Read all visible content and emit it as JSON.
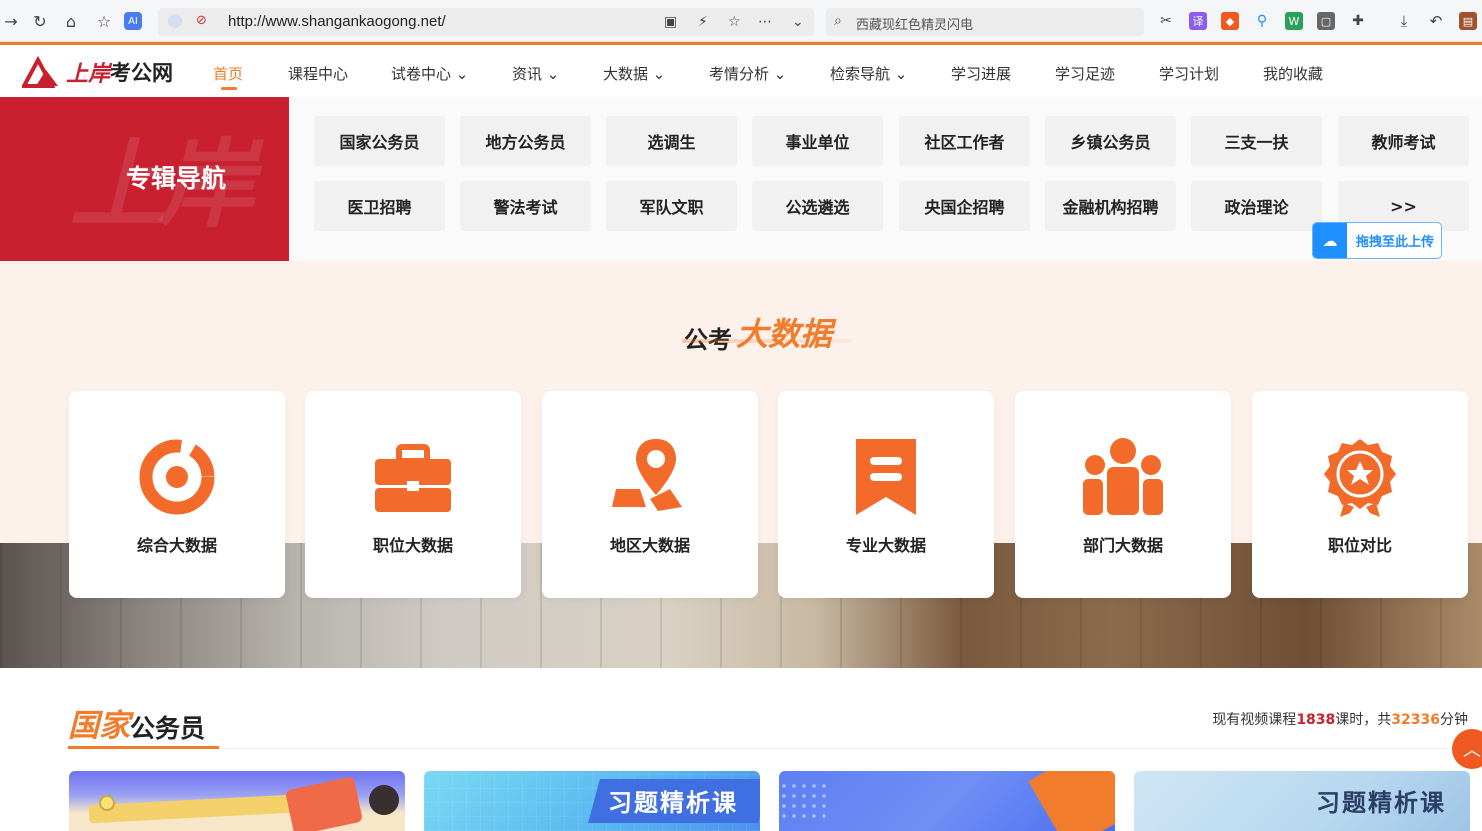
{
  "browser": {
    "url": "http://www.shangankaogong.net/",
    "search_placeholder": "西藏现红色精灵闪电"
  },
  "site": {
    "logo_brand": "上岸",
    "logo_suffix": "考公网",
    "nav": [
      {
        "label": "首页",
        "active": true
      },
      {
        "label": "课程中心"
      },
      {
        "label": "试卷中心"
      },
      {
        "label": "资讯"
      },
      {
        "label": "大数据"
      },
      {
        "label": "考情分析"
      },
      {
        "label": "检索导航"
      },
      {
        "label": "学习进展"
      },
      {
        "label": "学习足迹"
      },
      {
        "label": "学习计划"
      },
      {
        "label": "我的收藏"
      }
    ]
  },
  "special_nav": {
    "title": "专辑导航",
    "bg_text": "上岸",
    "tags": [
      "国家公务员",
      "地方公务员",
      "选调生",
      "事业单位",
      "社区工作者",
      "乡镇公务员",
      "三支一扶",
      "教师考试",
      "医卫招聘",
      "警法考试",
      "军队文职",
      "公选遴选",
      "央国企招聘",
      "金融机构招聘",
      "政治理论",
      ">>"
    ],
    "upload_label": "拖拽至此上传"
  },
  "big_data": {
    "title_a": "公考",
    "title_b": "大数据",
    "cards": [
      {
        "label": "综合大数据",
        "icon": "donut-chart-icon"
      },
      {
        "label": "职位大数据",
        "icon": "briefcase-icon"
      },
      {
        "label": "地区大数据",
        "icon": "map-pin-icon"
      },
      {
        "label": "专业大数据",
        "icon": "bookmark-icon"
      },
      {
        "label": "部门大数据",
        "icon": "people-icon"
      },
      {
        "label": "职位对比",
        "icon": "medal-icon"
      }
    ]
  },
  "national": {
    "title_a": "国家",
    "title_b": "公务员",
    "stats_prefix": "现有视频课程",
    "lessons": "1838",
    "stats_mid": "课时，共",
    "minutes": "32336",
    "stats_suffix": "分钟",
    "courses": [
      {
        "label": ""
      },
      {
        "label": "习题精析课"
      },
      {
        "label": ""
      },
      {
        "label": "习题精析课"
      }
    ]
  },
  "colors": {
    "accent": "#f07c2c",
    "brand_red": "#c8202f"
  }
}
